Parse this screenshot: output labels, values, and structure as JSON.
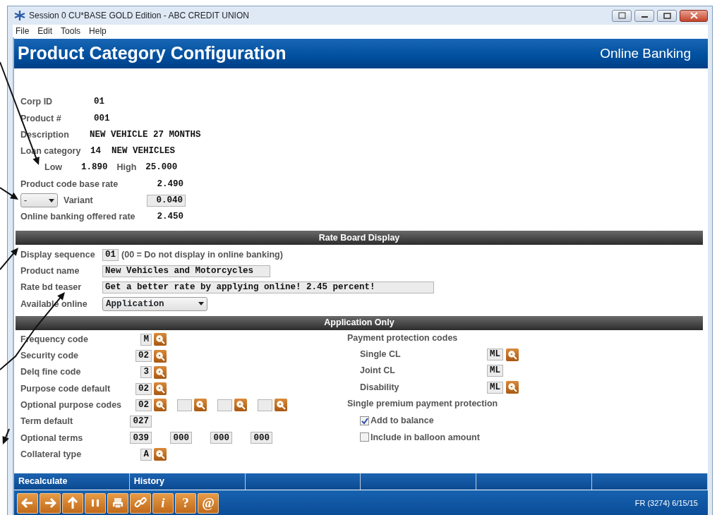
{
  "window": {
    "title": "Session 0 CU*BASE GOLD Edition - ABC CREDIT UNION",
    "menu": [
      "File",
      "Edit",
      "Tools",
      "Help"
    ]
  },
  "header": {
    "title": "Product Category Configuration",
    "subtitle": "Online Banking"
  },
  "details": {
    "corp_id": {
      "label": "Corp ID",
      "value": "01"
    },
    "product_no": {
      "label": "Product  #",
      "value": "001"
    },
    "description": {
      "label": "Description",
      "value": "NEW VEHICLE 27 MONTHS"
    },
    "loan_category": {
      "label": "Loan category",
      "value": "14  NEW VEHICLES"
    },
    "low": {
      "label": "Low",
      "value": "1.890"
    },
    "high": {
      "label": "High",
      "value": "25.000"
    },
    "base_rate": {
      "label": "Product code base rate",
      "value": "2.490"
    },
    "variant_sign": {
      "value": "-"
    },
    "variant": {
      "label": "Variant",
      "value": "0.040"
    },
    "offered_rate": {
      "label": "Online banking offered rate",
      "value": "2.450"
    }
  },
  "rate_board": {
    "title": "Rate Board Display",
    "display_sequence": {
      "label": "Display sequence",
      "value": "01",
      "note": "(00 = Do not display in online banking)"
    },
    "product_name": {
      "label": "Product name",
      "value": "New Vehicles and Motorcycles"
    },
    "teaser": {
      "label": "Rate bd teaser",
      "value": "Get a better rate by applying online! 2.45 percent!"
    },
    "available_online": {
      "label": "Available online",
      "value": "Application"
    }
  },
  "application": {
    "title": "Application Only",
    "rows": [
      {
        "label": "Frequency code",
        "fields": [
          {
            "value": "M",
            "lookup": true
          }
        ]
      },
      {
        "label": "Security code",
        "fields": [
          {
            "value": "02",
            "lookup": true
          }
        ]
      },
      {
        "label": "Delq fine code",
        "fields": [
          {
            "value": "3",
            "lookup": true
          }
        ]
      },
      {
        "label": "Purpose code default",
        "fields": [
          {
            "value": "02",
            "lookup": true
          }
        ]
      },
      {
        "label": "Optional purpose codes",
        "fields": [
          {
            "value": "02",
            "lookup": true
          },
          {
            "lookup": true
          },
          {
            "lookup": true
          },
          {
            "lookup": true
          }
        ]
      },
      {
        "label": "Term default",
        "fields": [
          {
            "value": "027",
            "lookup": false
          }
        ]
      },
      {
        "label": "Optional terms",
        "fields": [
          {
            "value": "039",
            "lookup": false
          },
          {
            "value": "000",
            "lookup": false
          },
          {
            "value": "000",
            "lookup": false
          },
          {
            "value": "000",
            "lookup": false
          }
        ]
      },
      {
        "label": "Collateral type",
        "fields": [
          {
            "value": "A",
            "lookup": true
          }
        ]
      }
    ],
    "protection_title": "Payment protection codes",
    "protection": [
      {
        "label": "Single CL",
        "value": "ML",
        "lookup": true
      },
      {
        "label": "Joint CL",
        "value": "ML",
        "lookup": false
      },
      {
        "label": "Disability",
        "value": "ML",
        "lookup": true
      }
    ],
    "premium_title": "Single premium payment protection",
    "options": [
      {
        "label": "Add to balance",
        "checked": true
      },
      {
        "label": "Include in balloon amount",
        "checked": false
      }
    ]
  },
  "function_keys": [
    "Recalculate",
    "History"
  ],
  "toolbar": [
    {
      "kind": "back"
    },
    {
      "kind": "forward"
    },
    {
      "kind": "up"
    },
    {
      "kind": "pause"
    },
    {
      "kind": "print"
    },
    {
      "kind": "link"
    },
    {
      "kind": "glyph",
      "glyph": "i"
    },
    {
      "kind": "glyph",
      "glyph": "?"
    },
    {
      "kind": "glyph",
      "glyph": "@"
    }
  ],
  "status": "FR (3274) 6/15/15"
}
